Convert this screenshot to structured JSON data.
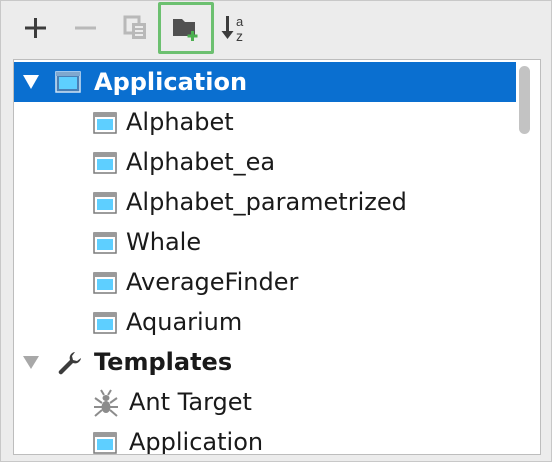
{
  "toolbar": {
    "buttons": [
      {
        "name": "add-icon",
        "symbol": "+"
      },
      {
        "name": "remove-icon",
        "symbol": "−"
      },
      {
        "name": "copy-icon",
        "symbol": ""
      },
      {
        "name": "new-folder-icon",
        "symbol": ""
      },
      {
        "name": "sort-alphabetically-icon",
        "symbol": "a z"
      }
    ],
    "highlight_color": "#6cc070"
  },
  "tree": {
    "selection_color": "#0a6fd0",
    "items": [
      {
        "label": "Application",
        "level": 0,
        "bold": true,
        "selected": true,
        "expanded": true,
        "icon": "application-config-icon"
      },
      {
        "label": "Alphabet",
        "level": 1,
        "icon": "application-config-icon"
      },
      {
        "label": "Alphabet_ea",
        "level": 1,
        "icon": "application-config-icon"
      },
      {
        "label": "Alphabet_parametrized",
        "level": 1,
        "icon": "application-config-icon"
      },
      {
        "label": "Whale",
        "level": 1,
        "icon": "application-config-icon"
      },
      {
        "label": "AverageFinder",
        "level": 1,
        "icon": "application-config-icon"
      },
      {
        "label": "Aquarium",
        "level": 1,
        "icon": "application-config-icon"
      },
      {
        "label": "Templates",
        "level": 0,
        "bold": true,
        "expanded": true,
        "icon": "wrench-icon"
      },
      {
        "label": "Ant Target",
        "level": 1,
        "icon": "ant-icon"
      },
      {
        "label": "Application",
        "level": 1,
        "icon": "application-config-icon"
      }
    ]
  }
}
